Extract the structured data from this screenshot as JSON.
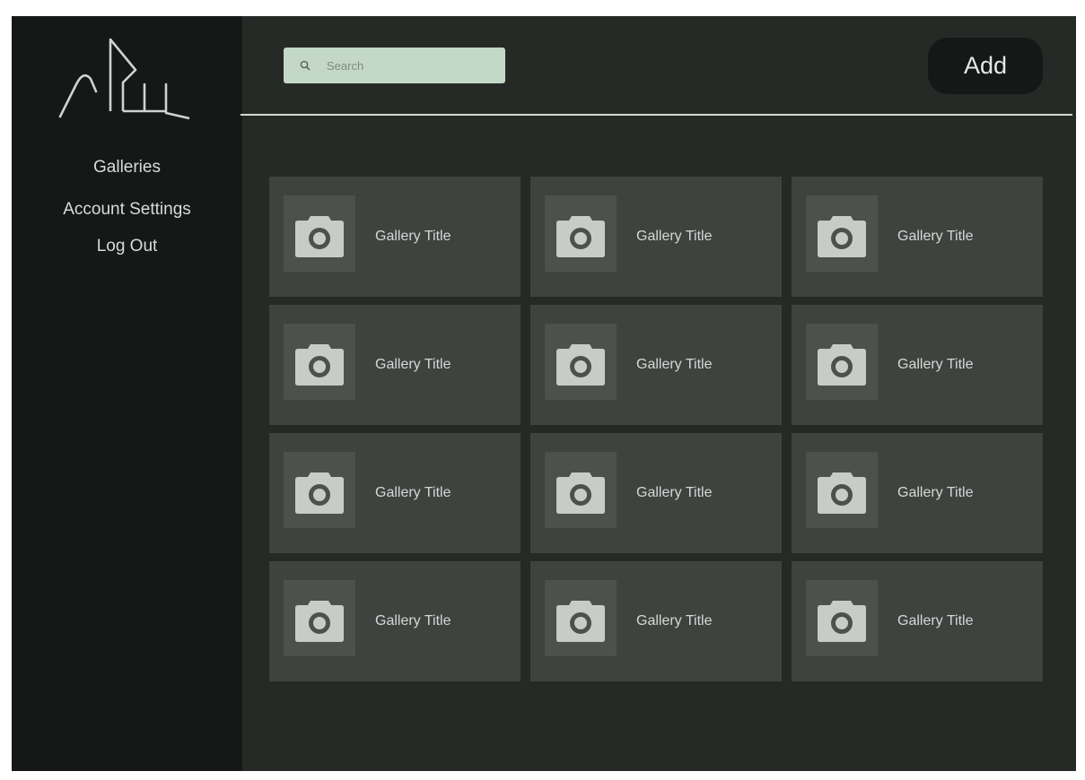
{
  "sidebar": {
    "logo_icon": "brand-logo-icon",
    "nav": [
      {
        "label": "Galleries"
      },
      {
        "label": "Account Settings"
      },
      {
        "label": "Log Out"
      }
    ]
  },
  "header": {
    "search_placeholder": "Search",
    "search_icon": "search-icon",
    "add_label": "Add"
  },
  "galleries": [
    {
      "title": "Gallery Title",
      "icon": "camera-icon"
    },
    {
      "title": "Gallery Title",
      "icon": "camera-icon"
    },
    {
      "title": "Gallery Title",
      "icon": "camera-icon"
    },
    {
      "title": "Gallery Title",
      "icon": "camera-icon"
    },
    {
      "title": "Gallery Title",
      "icon": "camera-icon"
    },
    {
      "title": "Gallery Title",
      "icon": "camera-icon"
    },
    {
      "title": "Gallery Title",
      "icon": "camera-icon"
    },
    {
      "title": "Gallery Title",
      "icon": "camera-icon"
    },
    {
      "title": "Gallery Title",
      "icon": "camera-icon"
    },
    {
      "title": "Gallery Title",
      "icon": "camera-icon"
    },
    {
      "title": "Gallery Title",
      "icon": "camera-icon"
    },
    {
      "title": "Gallery Title",
      "icon": "camera-icon"
    }
  ],
  "colors": {
    "sidebar_bg": "#151816",
    "main_bg": "#262a27",
    "card_bg": "#3f4340",
    "search_bg": "#c4d8c7"
  }
}
